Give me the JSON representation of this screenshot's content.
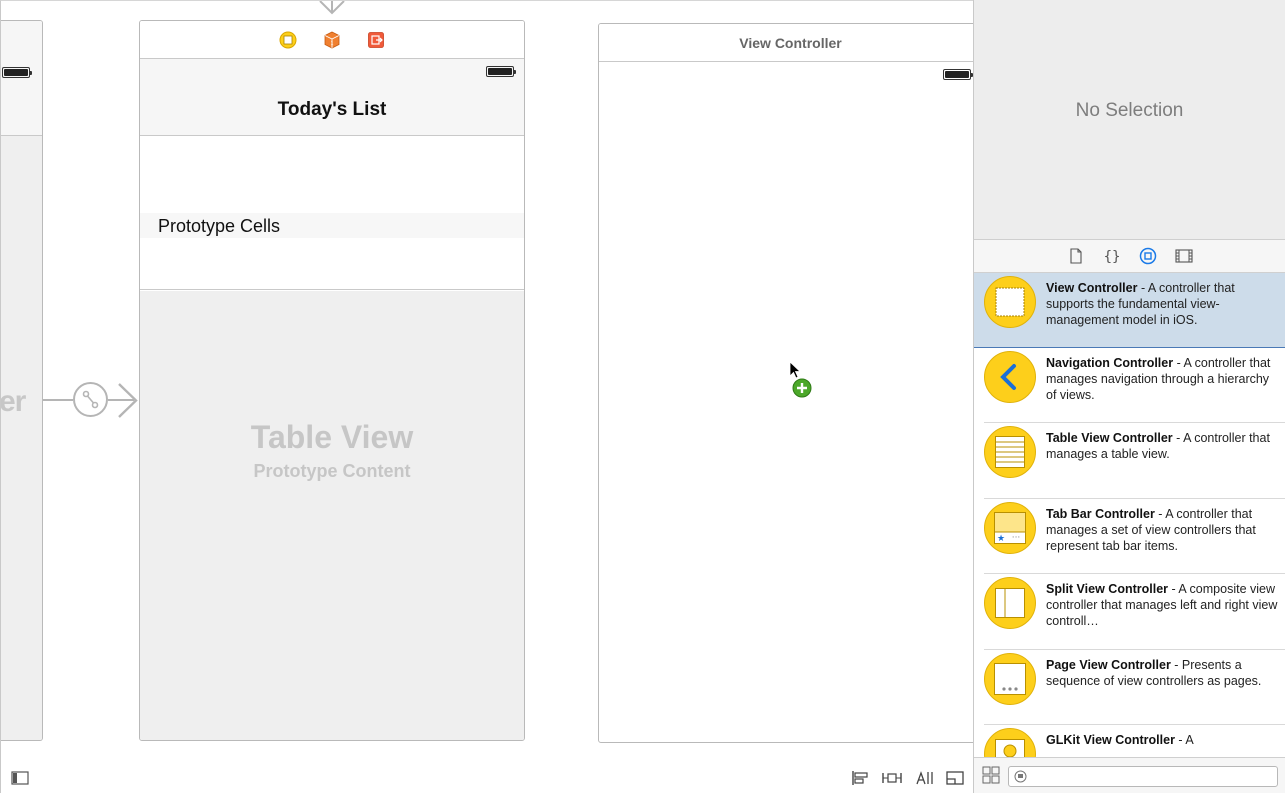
{
  "canvas": {
    "left_scene_partial_title": "er",
    "table_scene": {
      "nav_title": "Today's List",
      "section_header": "Prototype Cells",
      "placeholder_title": "Table View",
      "placeholder_subtitle": "Prototype Content",
      "dock_icons": [
        "view-controller-icon",
        "first-responder-icon",
        "exit-icon"
      ]
    },
    "vc_scene": {
      "title": "View Controller"
    },
    "toolbar_icons": [
      "document-outline-toggle-icon",
      "align-icon",
      "pin-icon",
      "resolve-auto-layout-icon",
      "resizing-icon"
    ]
  },
  "inspector": {
    "empty_label": "No Selection"
  },
  "library": {
    "tabs": [
      "file-template-icon",
      "code-snippet-icon",
      "object-library-icon",
      "media-library-icon"
    ],
    "active_tab": "object-library-icon",
    "items": [
      {
        "name": "View Controller",
        "desc": " - A controller that supports the fundamental view-management model in iOS.",
        "icon": "view-controller-icon",
        "selected": true
      },
      {
        "name": "Navigation Controller",
        "desc": " - A controller that manages navigation through a hierarchy of views.",
        "icon": "navigation-controller-icon",
        "selected": false
      },
      {
        "name": "Table View Controller",
        "desc": " - A controller that manages a table view.",
        "icon": "table-view-controller-icon",
        "selected": false
      },
      {
        "name": "Tab Bar Controller",
        "desc": " - A controller that manages a set of view controllers that represent tab bar items.",
        "icon": "tab-bar-controller-icon",
        "selected": false
      },
      {
        "name": "Split View Controller",
        "desc": " - A composite view controller that manages left and right view controll…",
        "icon": "split-view-controller-icon",
        "selected": false
      },
      {
        "name": "Page View Controller",
        "desc": " - Presents a sequence of view controllers as pages.",
        "icon": "page-view-controller-icon",
        "selected": false
      },
      {
        "name": "GLKit View Controller",
        "desc": " - A",
        "icon": "glkit-view-controller-icon",
        "selected": false
      }
    ],
    "filter_placeholder": ""
  },
  "colors": {
    "accent": "#fdcf1b",
    "selection": "#cddcea",
    "tab_active": "#1a7ae8"
  }
}
